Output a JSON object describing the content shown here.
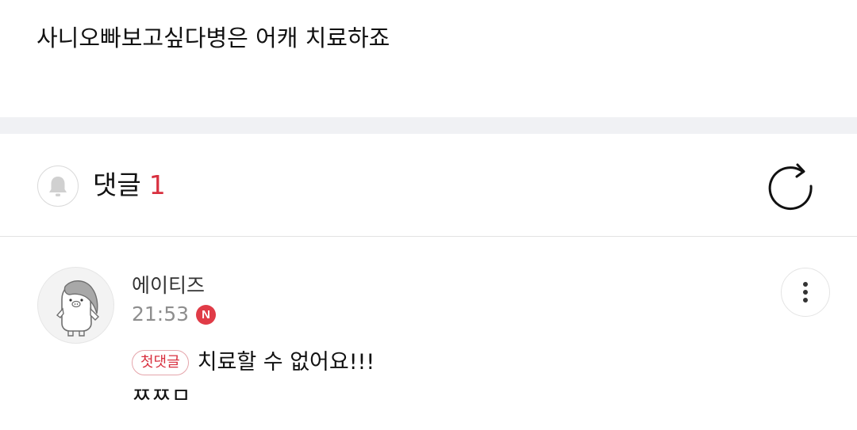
{
  "post": {
    "text": "사니오빠보고싶다병은 어캐 치료하죠"
  },
  "comments_header": {
    "title": "댓글",
    "count": "1",
    "bell_icon": "bell-icon",
    "refresh_icon": "refresh-icon"
  },
  "comment": {
    "author": "에이티즈",
    "time": "21:53",
    "new_badge": "N",
    "first_comment_badge": "첫댓글",
    "text_line1": "치료할 수 없어요!!!",
    "text_line2": "ㅉㅉㅁ",
    "more_icon": "more-vertical-icon",
    "avatar_icon": "character-avatar-icon"
  },
  "colors": {
    "accent_red": "#d8303f",
    "divider_gray": "#f0f1f4",
    "meta_gray": "#8e8e8e"
  }
}
